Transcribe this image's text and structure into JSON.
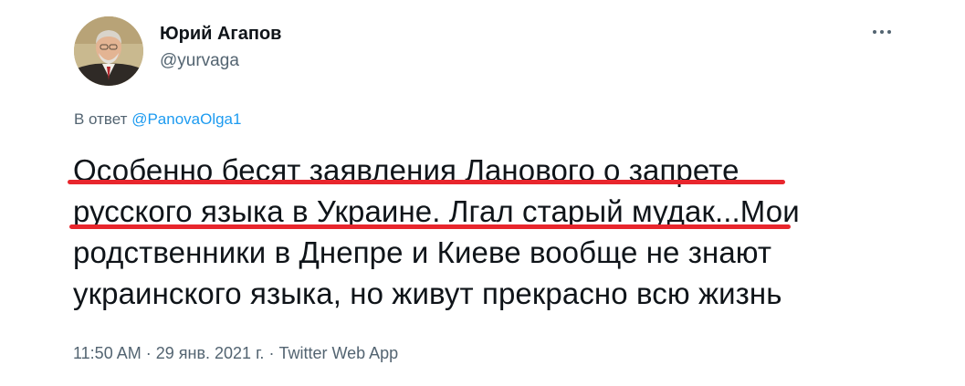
{
  "author": {
    "name": "Юрий Агапов",
    "handle": "@yurvaga"
  },
  "menu": {
    "more_icon": "more-horizontal-icon",
    "more_label": "···"
  },
  "reply": {
    "prefix": "В ответ",
    "mention": "@PanovaOlga1"
  },
  "tweet": {
    "lines": [
      "Особенно бесят заявления Ланового о запрете",
      "русского языка в Украине. Лгал старый мудак...Мои",
      "родственники в Днепре и Киеве вообще не знают",
      "украинского языка, но живут прекрасно всю жизнь"
    ],
    "highlight_color": "#e8262d"
  },
  "meta": {
    "time": "11:50 AM",
    "separator": "·",
    "date": "29 янв. 2021 г.",
    "source": "Twitter Web App"
  }
}
